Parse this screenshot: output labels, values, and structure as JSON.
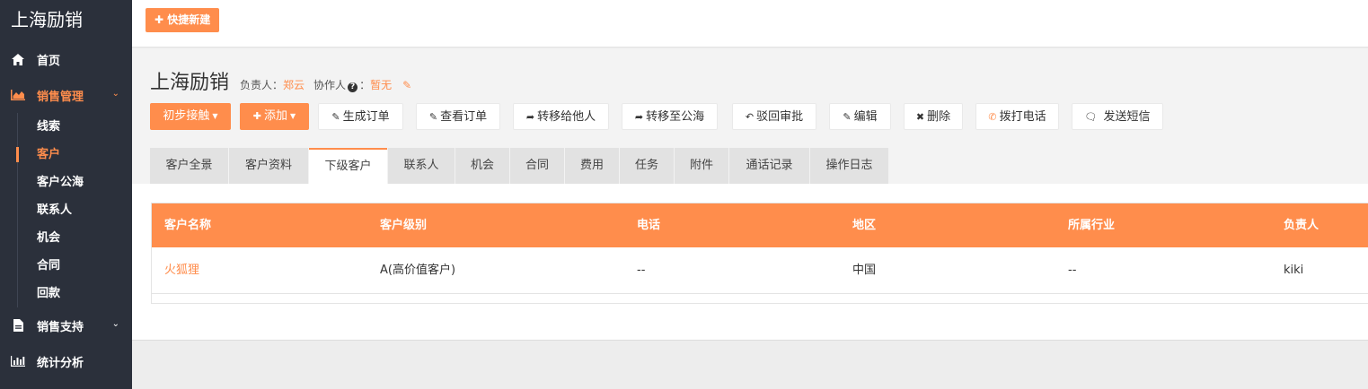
{
  "brand": "上海励销",
  "sidebar": {
    "items": [
      {
        "label": "首页",
        "icon": "home-icon"
      },
      {
        "label": "销售管理",
        "icon": "area-chart-icon",
        "active": true
      },
      {
        "label": "销售支持",
        "icon": "file-icon"
      },
      {
        "label": "统计分析",
        "icon": "bar-chart-icon"
      }
    ],
    "sub_items": [
      {
        "label": "线索"
      },
      {
        "label": "客户",
        "active": true
      },
      {
        "label": "客户公海"
      },
      {
        "label": "联系人"
      },
      {
        "label": "机会"
      },
      {
        "label": "合同"
      },
      {
        "label": "回款"
      }
    ]
  },
  "topbar": {
    "quick_new": "快捷新建"
  },
  "customer": {
    "name": "上海励销",
    "owner_label": "负责人：",
    "owner": "郑云",
    "collab_label": "协作人",
    "collab_colon": "：",
    "collab": "暂无"
  },
  "actions": {
    "initial_contact": "初步接触",
    "add": "添加",
    "generate_order": "生成订单",
    "view_order": "查看订单",
    "transfer_other": "转移给他人",
    "transfer_pool": "转移至公海",
    "reject_approval": "驳回审批",
    "edit": "编辑",
    "delete": "删除",
    "call": "拨打电话",
    "sms": "发送短信"
  },
  "tabs": [
    "客户全景",
    "客户资料",
    "下级客户",
    "联系人",
    "机会",
    "合同",
    "费用",
    "任务",
    "附件",
    "通话记录",
    "操作日志"
  ],
  "active_tab": "下级客户",
  "table": {
    "headers": [
      "客户名称",
      "客户级别",
      "电话",
      "地区",
      "所属行业",
      "负责人"
    ],
    "rows": [
      [
        "火狐狸",
        "A(高价值客户)",
        "--",
        "中国",
        "--",
        "kiki"
      ]
    ]
  },
  "colors": {
    "accent": "#ff8d4c",
    "sidebar_bg": "#2b303b"
  }
}
